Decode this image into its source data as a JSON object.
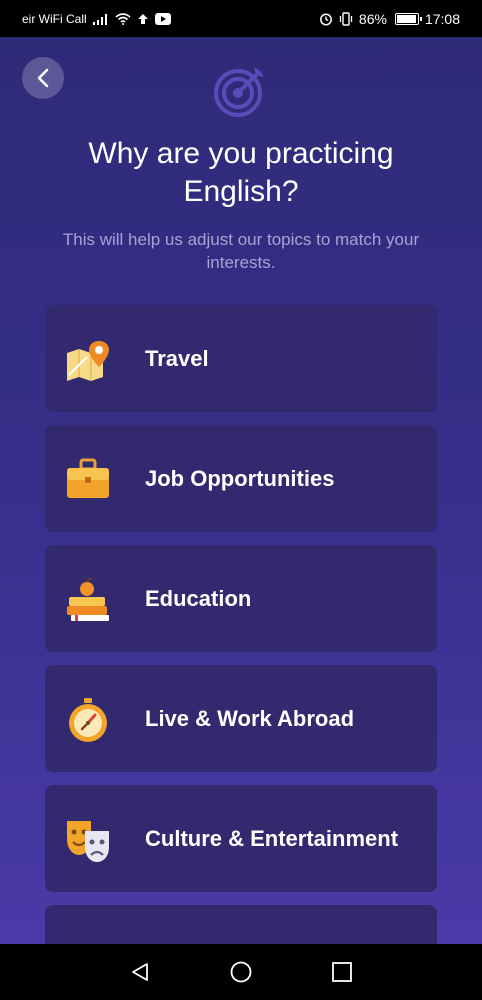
{
  "status_bar": {
    "carrier": "eir WiFi Call",
    "battery_percent": "86%",
    "battery_level": 0.86,
    "time": "17:08"
  },
  "header": {
    "title": "Why are you practicing English?",
    "subtitle": "This will help us adjust our topics to match your interests."
  },
  "options": [
    {
      "label": "Travel",
      "icon": "travel-map-icon"
    },
    {
      "label": "Job Opportunities",
      "icon": "briefcase-icon"
    },
    {
      "label": "Education",
      "icon": "books-apple-icon"
    },
    {
      "label": "Live & Work Abroad",
      "icon": "stopwatch-icon"
    },
    {
      "label": "Culture & Entertainment",
      "icon": "theater-masks-icon"
    },
    {
      "label": "",
      "icon": ""
    }
  ],
  "colors": {
    "background_top": "#2f2a78",
    "background_bottom": "#4a3aa8",
    "card": "#33296f",
    "subtitle": "#a8a2d6"
  }
}
